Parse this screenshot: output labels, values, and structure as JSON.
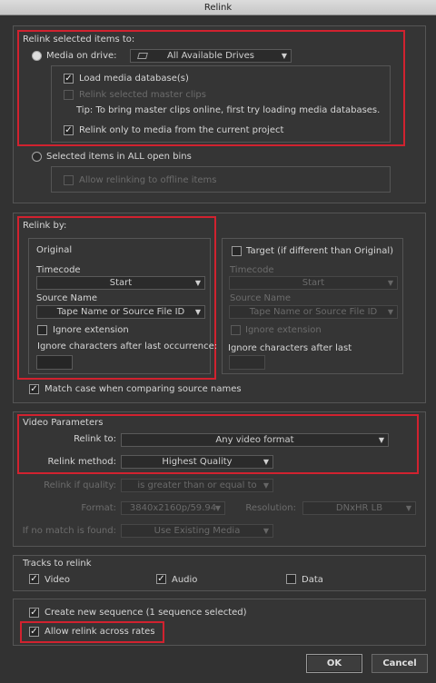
{
  "window": {
    "title": "Relink"
  },
  "relink_selected": {
    "heading": "Relink selected items to:",
    "media_on_drive": "Media on drive:",
    "drive_value": "All Available Drives",
    "load_db": "Load media database(s)",
    "relink_master": "Relink selected master clips",
    "tip": "Tip: To bring master clips online, first try loading media databases.",
    "relink_current": "Relink only to media from the current project",
    "selected_bins": "Selected items in ALL open bins",
    "allow_offline": "Allow relinking to offline items"
  },
  "relink_by": {
    "heading": "Relink by:",
    "original": {
      "title": "Original",
      "timecode_label": "Timecode",
      "timecode_value": "Start",
      "source_label": "Source Name",
      "source_value": "Tape Name or Source File ID",
      "ignore_ext": "Ignore extension",
      "ignore_chars": "Ignore characters after last occurrence:"
    },
    "target": {
      "title": "Target (if different than Original)",
      "timecode_label": "Timecode",
      "timecode_value": "Start",
      "source_label": "Source Name",
      "source_value": "Tape Name or Source File ID",
      "ignore_ext": "Ignore extension",
      "ignore_chars": "Ignore characters after last"
    },
    "match_case": "Match case when comparing source names"
  },
  "video": {
    "heading": "Video Parameters",
    "relink_to_label": "Relink to:",
    "relink_to_value": "Any video format",
    "method_label": "Relink method:",
    "method_value": "Highest Quality",
    "quality_label": "Relink if quality:",
    "quality_value": "is greater than or equal to",
    "format_label": "Format:",
    "format_value": "3840x2160p/59.94",
    "resolution_label": "Resolution:",
    "resolution_value": "DNxHR LB",
    "nomatch_label": "If no match is found:",
    "nomatch_value": "Use Existing Media"
  },
  "tracks": {
    "heading": "Tracks to relink",
    "video": "Video",
    "audio": "Audio",
    "data": "Data"
  },
  "options": {
    "create_seq": "Create new sequence  (1 sequence selected)",
    "allow_rates": "Allow relink across rates"
  },
  "buttons": {
    "ok": "OK",
    "cancel": "Cancel"
  },
  "colors": {
    "highlight": "#d1222f",
    "background": "#323232"
  }
}
